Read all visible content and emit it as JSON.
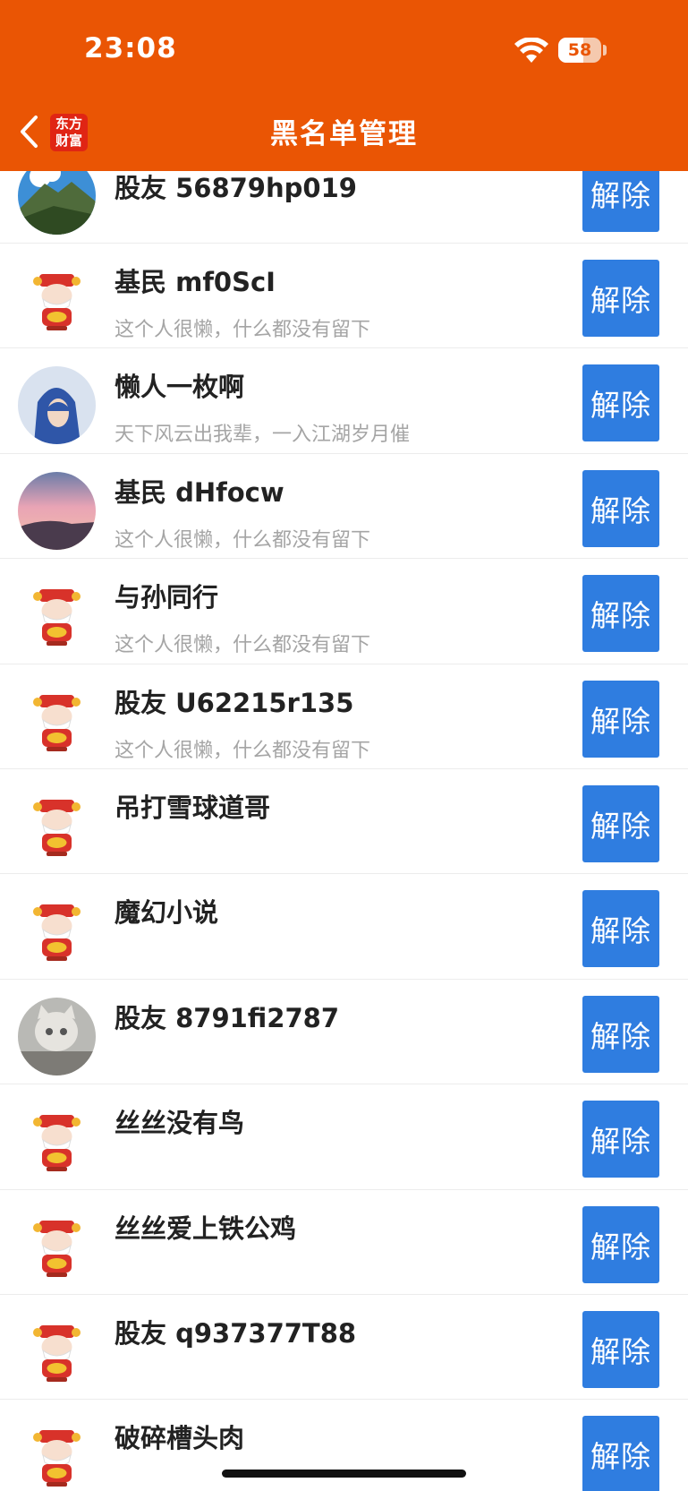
{
  "status_bar": {
    "time": "23:08",
    "battery": "58",
    "battery_level": 0.58
  },
  "header": {
    "title": "黑名单管理",
    "logo_line1": "东方",
    "logo_line2": "财富",
    "accent": "#ea5504"
  },
  "unblock_label": "解除",
  "rows": [
    {
      "name": "股友 56879hp019",
      "signature": "",
      "avatar": "mountain"
    },
    {
      "name": "基民 mf0ScI",
      "signature": "这个人很懒，什么都没有留下",
      "avatar": "mascot"
    },
    {
      "name": "懒人一枚啊",
      "signature": "天下风云出我辈，一入江湖岁月催",
      "avatar": "hooded"
    },
    {
      "name": "基民 dHfocw",
      "signature": "这个人很懒，什么都没有留下",
      "avatar": "sunset"
    },
    {
      "name": "与孙同行",
      "signature": "这个人很懒，什么都没有留下",
      "avatar": "mascot"
    },
    {
      "name": "股友 U62215r135",
      "signature": "这个人很懒，什么都没有留下",
      "avatar": "mascot"
    },
    {
      "name": "吊打雪球道哥",
      "signature": "",
      "avatar": "mascot"
    },
    {
      "name": "魔幻小说",
      "signature": "",
      "avatar": "mascot"
    },
    {
      "name": "股友 8791fi2787",
      "signature": "",
      "avatar": "cat"
    },
    {
      "name": "丝丝没有鸟",
      "signature": "",
      "avatar": "mascot"
    },
    {
      "name": "丝丝爱上铁公鸡",
      "signature": "",
      "avatar": "mascot"
    },
    {
      "name": "股友 q937377T88",
      "signature": "",
      "avatar": "mascot"
    },
    {
      "name": "破碎槽头肉",
      "signature": "",
      "avatar": "mascot"
    }
  ]
}
